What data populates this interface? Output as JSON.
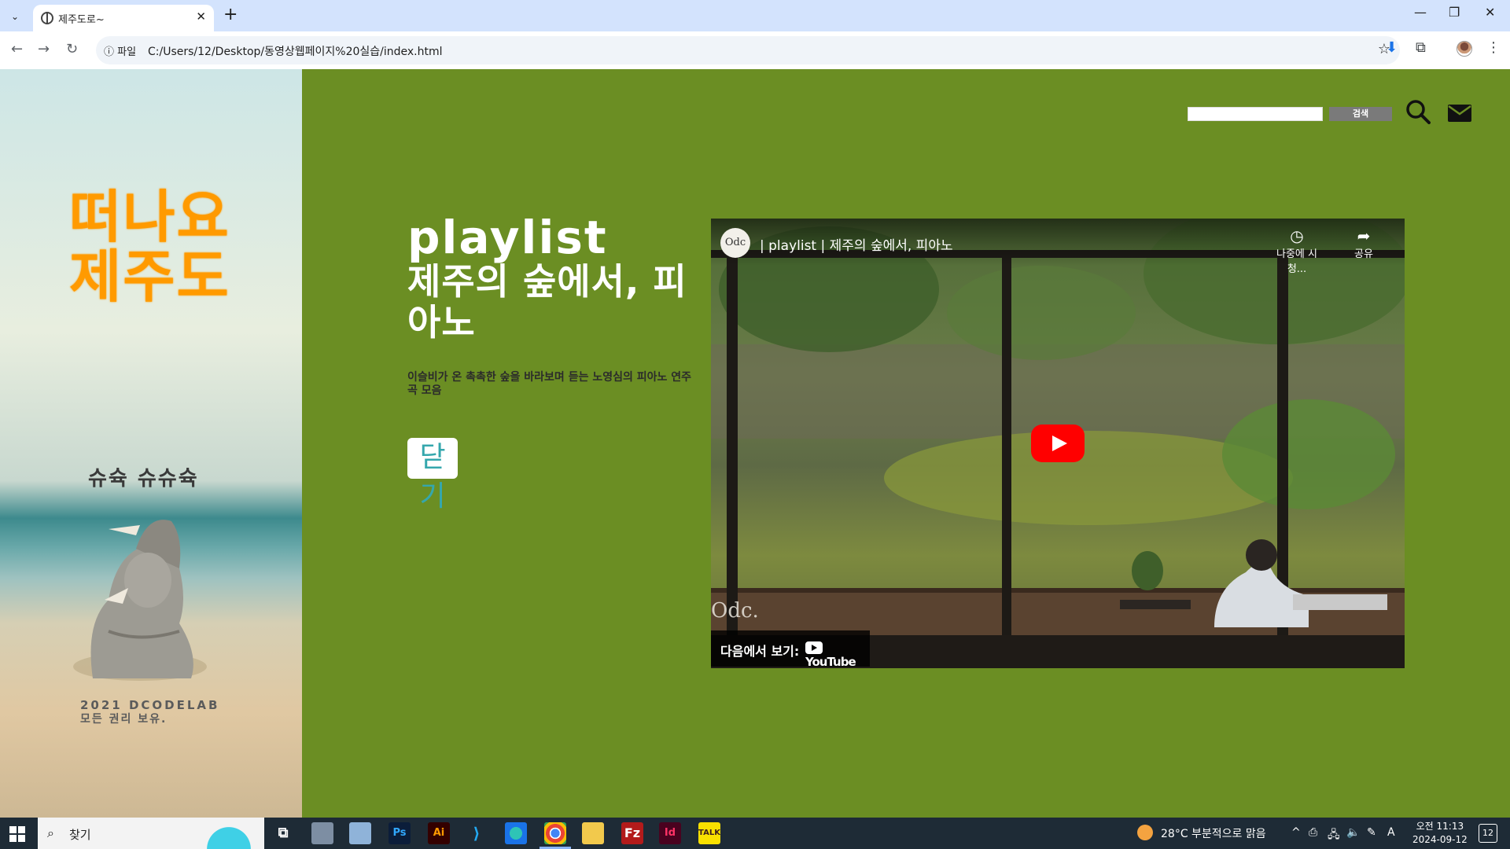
{
  "browser": {
    "tab_title": "제주도로~",
    "omnibox_prefix": "파일",
    "url": "C:/Users/12/Desktop/동영상웹페이지%20실습/index.html"
  },
  "sidebar": {
    "brand_line1": "떠나요",
    "brand_line2": "제주도",
    "tagline": "슈슉 슈슈슉",
    "copyright_line1": "2021 DCODELAB",
    "copyright_line2": "모든 권리 보유."
  },
  "header": {
    "search_input_value": "",
    "search_button_label": "검색"
  },
  "content": {
    "title_line1": "playlist",
    "title_line2": "제주의 숲에서, 피아노",
    "description": "이슬비가 온 촉촉한 숲을 바라보며 듣는 노영심의 피아노 연주곡 모음",
    "close_button_label": "닫기"
  },
  "video": {
    "channel_logo_text": "Odc",
    "title": "| playlist | 제주의 숲에서, 피아노",
    "watch_later_label": "나중에 시청...",
    "share_label": "공유",
    "watermark": "Odc.",
    "watch_on_label": "다음에서 보기:",
    "youtube_label": "YouTube"
  },
  "taskbar": {
    "search_label": "찾기",
    "weather_text": "28°C  부분적으로 맑음",
    "clock_time": "오전 11:13",
    "clock_date": "2024-09-12",
    "notification_count": "12",
    "ime_label": "A"
  },
  "colors": {
    "main_bg": "#6b8e23",
    "brand_orange": "#ff9a00",
    "close_text": "#35a7ad",
    "play_red": "#ff0000"
  },
  "icons": [
    "globe-icon",
    "close-icon",
    "plus-icon",
    "back-icon",
    "forward-icon",
    "reload-icon",
    "info-icon",
    "star-icon",
    "download-icon",
    "extensions-icon",
    "search-icon",
    "mail-icon",
    "clock-icon",
    "share-icon",
    "play-icon",
    "windows-icon"
  ]
}
